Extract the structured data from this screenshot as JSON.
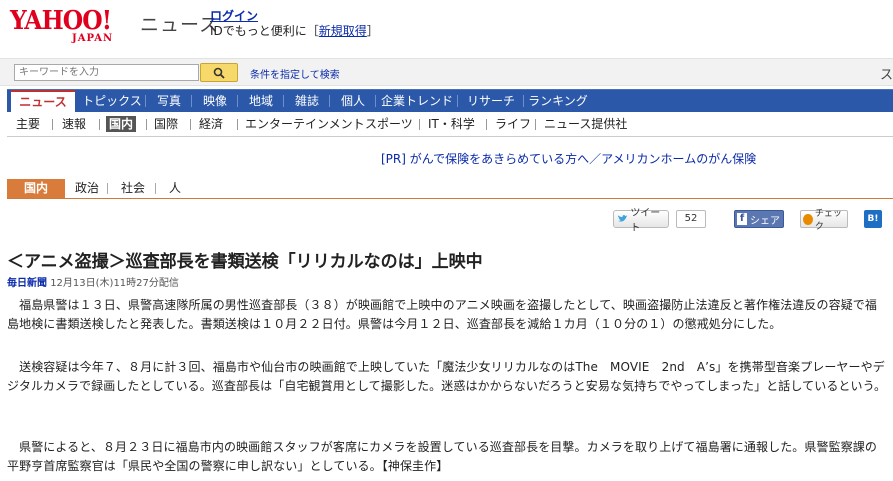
{
  "header": {
    "logo_text": "YAHOO!",
    "logo_sub": "JAPAN",
    "site_name": "ニュース",
    "login_label": "ログイン",
    "login_sub": "IDでもっと便利に［",
    "register_label": "新規取得",
    "login_sub_end": "］"
  },
  "search": {
    "placeholder": "キーワードを入力",
    "advanced_label": "条件を指定して検索",
    "close_glyph": "ス"
  },
  "main_nav": {
    "items": [
      "ニュース",
      "トピックス",
      "写真",
      "映像",
      "地域",
      "雑誌",
      "個人",
      "企業トレンド",
      "リサーチ",
      "ランキング"
    ],
    "active_index": 0
  },
  "sub_nav": {
    "items": [
      "主要",
      "速報",
      "国内",
      "国際",
      "経済",
      "エンターテインメント",
      "スポーツ",
      "IT・科学",
      "ライフ",
      "ニュース提供社"
    ],
    "active_index": 2
  },
  "pr_line": "[PR] がんで保険をあきらめている方へ／アメリカンホームのがん保険",
  "category_tabs": {
    "items": [
      "国内",
      "政治",
      "社会",
      "人"
    ],
    "active_index": 0
  },
  "social": {
    "tweet_label": "ツイート",
    "tweet_count": "52",
    "facebook_label": "シェア",
    "check_label": "チェック",
    "hatena_label": "B!"
  },
  "article": {
    "headline": "＜アニメ盗撮＞巡査部長を書類送検「リリカルなのは」上映中",
    "source": "毎日新聞",
    "date": "12月13日(木)11時27分配信",
    "paragraphs": [
      "福島県警は１３日、県警高速隊所属の男性巡査部長（３８）が映画館で上映中のアニメ映画を盗撮したとして、映画盗撮防止法違反と著作権法違反の容疑で福島地検に書類送検したと発表した。書類送検は１０月２２日付。県警は今月１２日、巡査部長を減給１カ月（１０分の１）の懲戒処分にした。",
      "送検容疑は今年７、８月に計３回、福島市や仙台市の映画館で上映していた「魔法少女リリカルなのはThe　MOVIE　2nd　A’s」を携帯型音楽プレーヤーやデジタルカメラで録画したとしている。巡査部長は「自宅観賞用として撮影した。迷惑はかからないだろうと安易な気持ちでやってしまった」と話しているという。",
      "県警によると、８月２３日に福島市内の映画館スタッフが客席にカメラを設置している巡査部長を目撃。カメラを取り上げて福島署に通報した。県警監察課の平野亨首席監察官は「県民や全国の警察に申し訳ない」としている。【神保圭作】"
    ]
  }
}
